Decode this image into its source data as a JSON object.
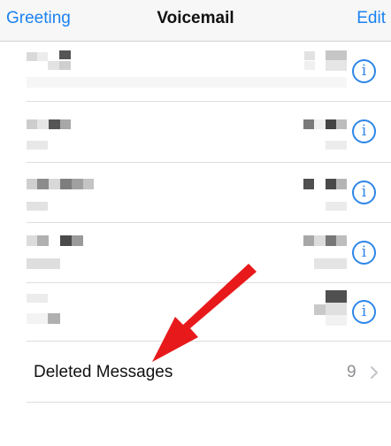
{
  "navbar": {
    "left_label": "Greeting",
    "title": "Voicemail",
    "right_label": "Edit"
  },
  "voicemail_rows": [
    {
      "info_glyph": "i"
    },
    {
      "info_glyph": "i"
    },
    {
      "info_glyph": "i"
    },
    {
      "info_glyph": "i"
    },
    {
      "info_glyph": "i"
    }
  ],
  "deleted_messages": {
    "label": "Deleted Messages",
    "count": "9",
    "chevron_icon": "chevron-right-icon"
  },
  "colors": {
    "accent_blue": "#1a82f0",
    "arrow_red": "#e8191b",
    "secondary_text": "#8e8e93"
  }
}
